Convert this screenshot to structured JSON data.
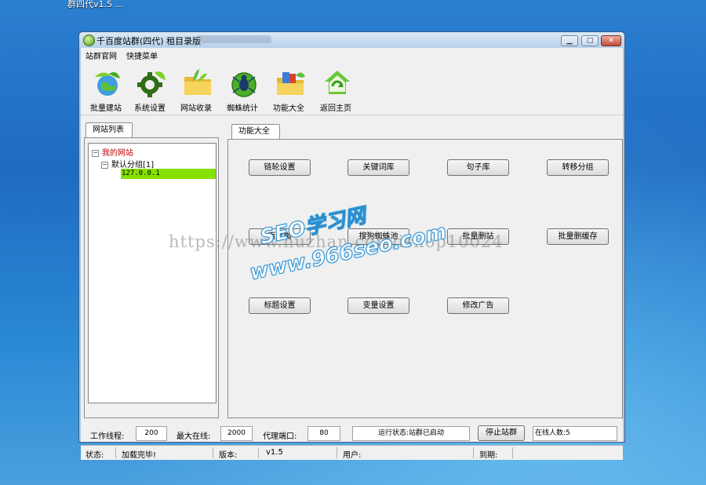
{
  "desktop": {
    "label": "群四代v1.5 ..."
  },
  "window": {
    "title": "千百度站群(四代) 租目录版",
    "min_glyph": "▁",
    "max_glyph": "□",
    "close_glyph": "✕"
  },
  "menu": [
    "站群官网",
    "快捷菜单"
  ],
  "toolbar": [
    {
      "label": "批量建站",
      "icon": "globe-leaf-icon"
    },
    {
      "label": "系统设置",
      "icon": "gear-icon"
    },
    {
      "label": "网站收录",
      "icon": "folder-leaf-icon"
    },
    {
      "label": "蜘蛛统计",
      "icon": "spider-globe-icon"
    },
    {
      "label": "功能大全",
      "icon": "folder-book-icon"
    },
    {
      "label": "返回主页",
      "icon": "home-recycle-icon"
    }
  ],
  "left_panel": {
    "tab": "网站列表",
    "tree": {
      "root": "我的网站",
      "group": "默认分组[1]",
      "selected": "127.0.0.1",
      "expander": "⊟"
    }
  },
  "right_panel": {
    "tab": "功能大全",
    "buttons": [
      "链轮设置",
      "关键词库",
      "句子库",
      "转移分组",
      "百度蜘",
      "搜狗蜘蛛池",
      "批量删站",
      "批量删缓存",
      "标题设置",
      "变量设置",
      "修改广告"
    ]
  },
  "bottom": {
    "threads_label": "工作线程:",
    "threads_value": "200",
    "max_online_label": "最大在线:",
    "max_online_value": "2000",
    "proxy_port_label": "代理端口:",
    "proxy_port_value": "80",
    "run_status": "运行状态:站群已启动",
    "stop_button": "停止站群",
    "online_count": "在线人数:5"
  },
  "statusbar": {
    "status_label": "状态:",
    "status_value": "加载完毕!",
    "version_label": "版本:",
    "version_value": "v1.5",
    "user_label": "用户:",
    "expire_label": "到期:"
  },
  "watermark": {
    "url": "https://www.huzhan.com/ishop10024",
    "brand": "SEO学习网",
    "site": "www.966seo.com"
  }
}
